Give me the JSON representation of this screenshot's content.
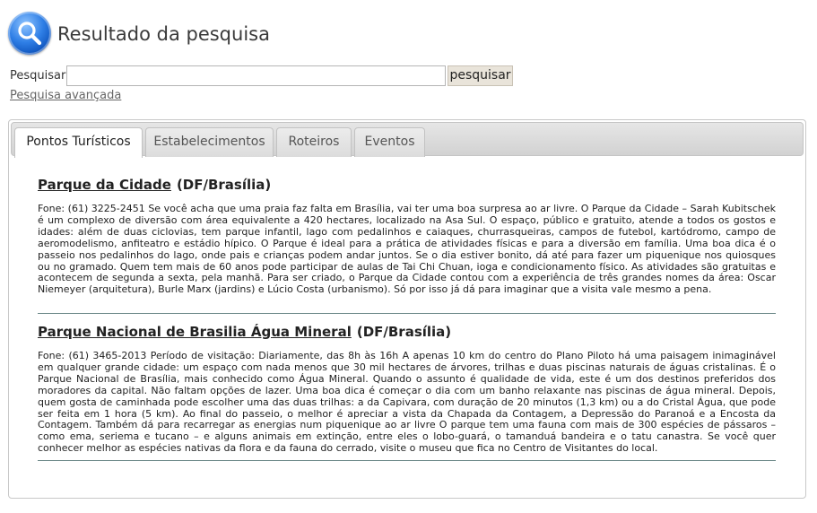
{
  "header": {
    "title": "Resultado da pesquisa",
    "logo_icon": "search-icon"
  },
  "search": {
    "label": "Pesquisar:",
    "value": "",
    "placeholder": "",
    "button_label": "pesquisar",
    "advanced_link": "Pesquisa avançada"
  },
  "tabs": [
    {
      "label": "Pontos Turísticos",
      "active": true
    },
    {
      "label": "Estabelecimentos",
      "active": false
    },
    {
      "label": "Roteiros",
      "active": false
    },
    {
      "label": "Eventos",
      "active": false
    }
  ],
  "results": [
    {
      "title": "Parque da Cidade",
      "location": "(DF/Brasília)",
      "description": "Fone: (61) 3225-2451 Se você acha que uma praia faz falta em Brasília, vai ter uma boa surpresa ao ar livre. O Parque da Cidade – Sarah Kubitschek é um complexo de diversão com área equivalente a 420 hectares, localizado na Asa Sul. O espaço, público e gratuito, atende a todos os gostos e idades: além de duas ciclovias, tem parque infantil, lago com pedalinhos e caiaques, churrasqueiras, campos de futebol, kartódromo, campo de aeromodelismo, anfiteatro e estádio hípico. O Parque é ideal para a prática de atividades físicas e para a diversão em família. Uma boa dica é o passeio nos pedalinhos do lago, onde pais e crianças podem andar juntos. Se o dia estiver bonito, dá até para fazer um piquenique nos quiosques ou no gramado. Quem tem mais de 60 anos pode participar de aulas de Tai Chi Chuan, ioga e condicionamento físico. As atividades são gratuitas e acontecem de segunda a sexta, pela manhã. Para ser criado, o Parque da Cidade contou com a experiência de três grandes nomes da área: Oscar Niemeyer (arquitetura), Burle Marx (jardins) e Lúcio Costa (urbanismo). Só por isso já dá para imaginar que a visita vale mesmo a pena."
    },
    {
      "title": "Parque Nacional de Brasilia Água Mineral",
      "location": "(DF/Brasília)",
      "description": "Fone: (61) 3465-2013 Período de visitação: Diariamente, das 8h às 16h A apenas 10 km do centro do Plano Piloto há uma paisagem inimaginável em qualquer grande cidade: um espaço com nada menos que 30 mil hectares de árvores, trilhas e duas piscinas naturais de águas cristalinas. É o Parque Nacional de Brasília, mais conhecido como Água Mineral. Quando o assunto é qualidade de vida, este é um dos destinos preferidos dos moradores da capital. Não faltam opções de lazer. Uma boa dica é começar o dia com um banho relaxante nas piscinas de água mineral. Depois, quem gosta de caminhada pode escolher uma das duas trilhas: a da Capivara, com duração de 20 minutos (1,3 km) ou a do Cristal Água, que pode ser feita em 1 hora (5 km). Ao final do passeio, o melhor é apreciar a vista da Chapada da Contagem, a Depressão do Paranoá e a Encosta da Contagem. Também dá para recarregar as energias num piquenique ao ar livre O parque tem uma fauna com mais de 300 espécies de pássaros – como ema, seriema e tucano – e alguns animais em extinção, entre eles o lobo-guará, o tamanduá bandeira e o tatu canastra. Se você quer conhecer melhor as espécies nativas da flora e da fauna do cerrado, visite o museu que fica no Centro de Visitantes do local."
    }
  ]
}
